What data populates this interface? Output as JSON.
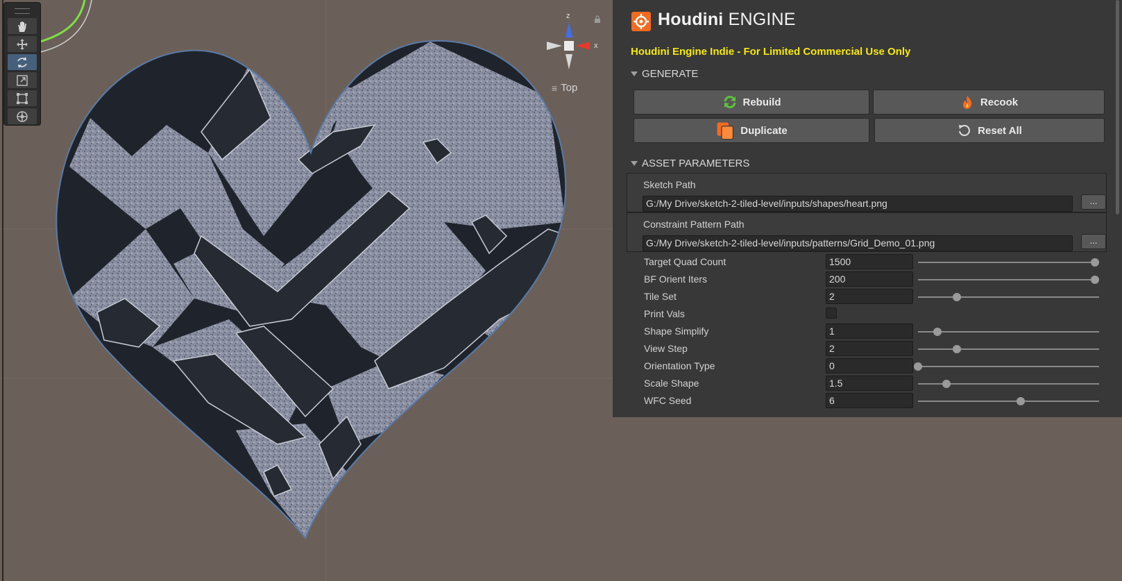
{
  "viewport": {
    "view_label": "Top",
    "axis_z": "z",
    "axis_x": "x",
    "tools": [
      {
        "name": "hand-tool",
        "icon": "hand-icon",
        "active": false
      },
      {
        "name": "move-tool",
        "icon": "move-icon",
        "active": false
      },
      {
        "name": "rotate-tool",
        "icon": "rotate-icon",
        "active": true
      },
      {
        "name": "scale-tool",
        "icon": "scale-icon",
        "active": false
      },
      {
        "name": "rect-tool",
        "icon": "rect-transform-icon",
        "active": false
      },
      {
        "name": "transform-tool",
        "icon": "transform-icon",
        "active": false
      }
    ]
  },
  "panel": {
    "logo_bold": "Houdini",
    "logo_light": "ENGINE",
    "license_text": "Houdini Engine Indie - For Limited Commercial Use Only",
    "generate_section": "GENERATE",
    "buttons": {
      "rebuild": "Rebuild",
      "recook": "Recook",
      "duplicate": "Duplicate",
      "reset_all": "Reset All"
    },
    "asset_section": "ASSET PARAMETERS",
    "sketch_path": {
      "label": "Sketch Path",
      "value": "G:/My Drive/sketch-2-tiled-level/inputs/shapes/heart.png",
      "browse": "..."
    },
    "constraint_path": {
      "label": "Constraint Pattern Path",
      "value": "G:/My Drive/sketch-2-tiled-level/inputs/patterns/Grid_Demo_01.png",
      "browse": "..."
    },
    "params": [
      {
        "label": "Target Quad Count",
        "value": "1500",
        "fraction": 1.0
      },
      {
        "label": "BF Orient Iters",
        "value": "200",
        "fraction": 1.0
      },
      {
        "label": "Tile Set",
        "value": "2",
        "fraction": 0.22
      },
      {
        "label": "Print Vals",
        "checkbox": true,
        "checked": false
      },
      {
        "label": "Shape Simplify",
        "value": "1",
        "fraction": 0.11
      },
      {
        "label": "View Step",
        "value": "2",
        "fraction": 0.22
      },
      {
        "label": "Orientation Type",
        "value": "0",
        "fraction": 0.0
      },
      {
        "label": "Scale Shape",
        "value": "1.5",
        "fraction": 0.16
      },
      {
        "label": "WFC Seed",
        "value": "6",
        "fraction": 0.58
      }
    ]
  },
  "colors": {
    "viewport_bg": "#6b6059",
    "panel_bg": "#383838",
    "license_yellow": "#f5e80e",
    "active_tool": "#46607c",
    "heart_dark": "#1f242c",
    "heart_light": "#8c91a3"
  }
}
